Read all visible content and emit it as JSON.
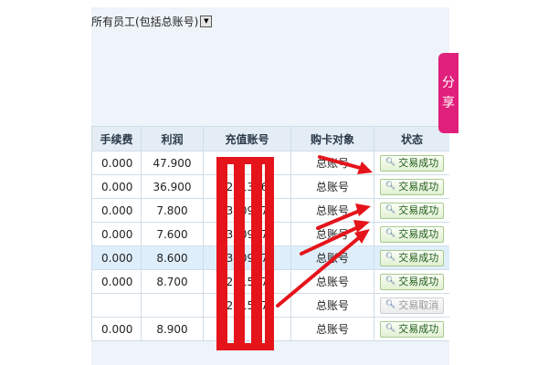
{
  "filter": {
    "selected": "所有员工(包括总账号)"
  },
  "share_tab": {
    "chars": [
      "分",
      "享"
    ]
  },
  "table": {
    "columns": [
      "手续费",
      "利润",
      "充值账号",
      "购卡对象",
      "状态"
    ],
    "rows": [
      {
        "fee": "0.000",
        "profit": "47.900",
        "account": "",
        "target": "总账号",
        "status": "交易成功",
        "active": true
      },
      {
        "fee": "0.000",
        "profit": "36.900",
        "account": "22813261",
        "target": "总账号",
        "status": "交易成功",
        "active": true
      },
      {
        "fee": "0.000",
        "profit": "7.800",
        "account": "33209577",
        "target": "总账号",
        "status": "交易成功",
        "active": true
      },
      {
        "fee": "0.000",
        "profit": "7.600",
        "account": "33209577",
        "target": "总账号",
        "status": "交易成功",
        "active": true
      },
      {
        "fee": "0.000",
        "profit": "8.600",
        "account": "33209577",
        "target": "总账号",
        "status": "交易成功",
        "active": true
      },
      {
        "fee": "0.000",
        "profit": "8.700",
        "account": "22315175",
        "target": "总账号",
        "status": "交易成功",
        "active": true
      },
      {
        "fee": "",
        "profit": "",
        "account": "22315175",
        "target": "总账号",
        "status": "交易取消",
        "active": false
      },
      {
        "fee": "0.000",
        "profit": "8.900",
        "account": "",
        "target": "总账号",
        "status": "交易成功",
        "active": true
      }
    ]
  },
  "colors": {
    "annotation_red": "#e5141b",
    "share_pink": "#e0207c",
    "header_bg": "#e4edf5"
  },
  "icons": {
    "status_button": "magnifier-icon",
    "dropdown": "dropdown-arrow-icon"
  }
}
